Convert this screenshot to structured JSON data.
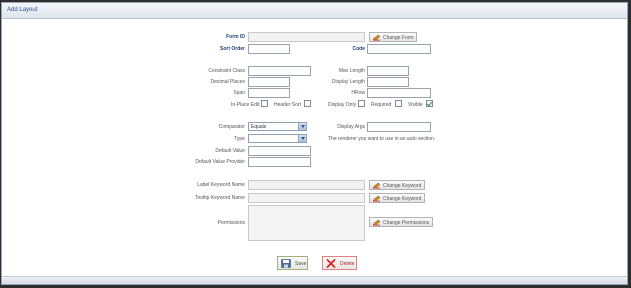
{
  "window": {
    "title": "Add Layout"
  },
  "form": {
    "form_id": {
      "label": "Form ID",
      "value": ""
    },
    "change_form": "Change Form",
    "sort_order": {
      "label": "Sort Order",
      "value": ""
    },
    "code": {
      "label": "Code",
      "value": ""
    },
    "constraint_class": {
      "label": "Constraint Class",
      "value": ""
    },
    "max_length": {
      "label": "Max Length",
      "value": ""
    },
    "decimal_places": {
      "label": "Decimal Places",
      "value": ""
    },
    "display_length": {
      "label": "Display Length",
      "value": ""
    },
    "span": {
      "label": "Span",
      "value": ""
    },
    "hrow": {
      "label": "HRow",
      "value": ""
    },
    "checks": {
      "in_place_edit": "In-Place Edit",
      "header_sort": "Header Sort",
      "display_only": "Display Only",
      "required": "Required",
      "visible": "Visible"
    },
    "comparator": {
      "label": "Comparator",
      "value": "Equals"
    },
    "display_args": {
      "label": "Display Args",
      "value": ""
    },
    "type": {
      "label": "Type",
      "value": ""
    },
    "renderer_note": "The renderer you want to use in an auto section.",
    "default_value": {
      "label": "Default Value",
      "value": ""
    },
    "default_value_provider": {
      "label": "Default Value Provider",
      "value": ""
    },
    "label_keyword_name": {
      "label": "Label Keyword Name",
      "value": ""
    },
    "change_keyword": "Change Keyword",
    "tooltip_keyword_name": {
      "label": "Tooltip Keyword Name",
      "value": ""
    },
    "change_keyword_2": "Change Keyword",
    "permissions": {
      "label": "Permissions"
    },
    "change_permissions": "Change Permissions"
  },
  "actions": {
    "save": "Save",
    "delete": "Delete"
  },
  "colors": {
    "accent": "#1e3f7a",
    "save": "#3c5a1e",
    "delete": "#b22222",
    "check": "#2a8a2a"
  },
  "icons": [
    "pencil-icon",
    "save-disk-icon",
    "delete-x-icon",
    "dropdown-arrow-icon",
    "checkmark-icon"
  ]
}
